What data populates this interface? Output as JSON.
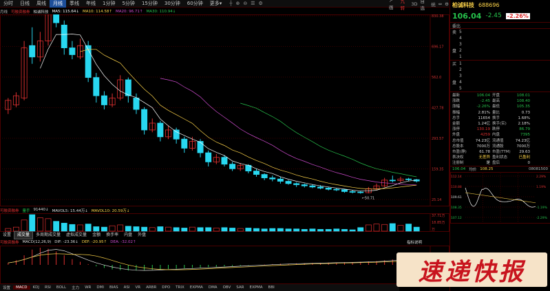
{
  "toolbar": {
    "periods": [
      {
        "label": "分时",
        "active": false
      },
      {
        "label": "日线",
        "active": false
      },
      {
        "label": "周线",
        "active": false
      },
      {
        "label": "月线",
        "active": true
      },
      {
        "label": "季线",
        "active": false
      },
      {
        "label": "年线",
        "active": false
      },
      {
        "label": "1分钟",
        "active": false
      },
      {
        "label": "5分钟",
        "active": false
      },
      {
        "label": "15分钟",
        "active": false
      },
      {
        "label": "30分钟",
        "active": false
      },
      {
        "label": "60分钟",
        "active": false
      },
      {
        "label": "更多▾",
        "active": false
      }
    ],
    "tools": [
      "┼",
      "⊕",
      "⊖",
      "☰",
      "⚙"
    ],
    "right": [
      "↗ 画",
      "九转",
      "3D",
      "自选",
      "统",
      "⇔",
      "⚙"
    ]
  },
  "main_chart": {
    "period_tag": "月线",
    "tag": "可融资融券",
    "name": "柏诚科技",
    "ma_legend": [
      {
        "label": "MA5: 115.64↓",
        "color": "#ffffff"
      },
      {
        "label": "MA10: 114.58↑",
        "color": "#ffd54a"
      },
      {
        "label": "MA20: 96.71↑",
        "color": "#d04cd0"
      },
      {
        "label": "MA30: 110.94↓",
        "color": "#27c24c"
      }
    ],
    "yticks": [
      "830.38",
      "696.17",
      "562.0",
      "427.78",
      "293.57",
      "159.35",
      "25.14"
    ],
    "high_label": "883.78",
    "low_label": "50.71"
  },
  "volume_panel": {
    "tag": "可融资融券",
    "legend": [
      {
        "label": "量手",
        "color": "#27c24c"
      },
      {
        "label": "91440↓",
        "color": "#dddddd"
      },
      {
        "label": "MAVOL5: 15.44万↓",
        "color": "#dddddd"
      },
      {
        "label": "MAVOL10: 20.59万↓",
        "color": "#ffd54a"
      }
    ],
    "yticks": [
      "37.71万",
      "18.85万",
      "万"
    ]
  },
  "sub_tabs": [
    {
      "label": "设置",
      "active": false
    },
    {
      "label": "成交量",
      "active": true
    },
    {
      "label": "多周期成交量",
      "active": false
    },
    {
      "label": "虚拟成交量",
      "active": false
    },
    {
      "label": "金额",
      "active": false
    },
    {
      "label": "换手率",
      "active": false
    },
    {
      "label": "内盘",
      "active": false
    },
    {
      "label": "外盘",
      "active": false
    }
  ],
  "macd_panel": {
    "tag": "可融资融券",
    "legend": [
      {
        "label": "MACD(12,26,9)",
        "color": "#dddddd"
      },
      {
        "label": "DIF: -23.36↓",
        "color": "#dddddd"
      },
      {
        "label": "DEF: -20.95↑",
        "color": "#ffd54a"
      },
      {
        "label": "DEA: -32.02↑",
        "color": "#d04cd0"
      }
    ],
    "hint": "指标说明"
  },
  "bottom_tabs": [
    {
      "label": "设置",
      "active": false
    },
    {
      "label": "MACD",
      "active": true
    },
    {
      "label": "KDJ",
      "active": false
    },
    {
      "label": "RSI",
      "active": false
    },
    {
      "label": "BOLL",
      "active": false
    },
    {
      "label": "主力",
      "active": false
    },
    {
      "label": "WR",
      "active": false
    },
    {
      "label": "DMI",
      "active": false
    },
    {
      "label": "BIAS",
      "active": false
    },
    {
      "label": "ASI",
      "active": false
    },
    {
      "label": "VR",
      "active": false
    },
    {
      "label": "ARBR",
      "active": false
    },
    {
      "label": "DPO",
      "active": false
    },
    {
      "label": "TRIX",
      "active": false
    },
    {
      "label": "EXPMA",
      "active": false
    },
    {
      "label": "DMA",
      "active": false
    },
    {
      "label": "OBV",
      "active": false
    },
    {
      "label": "SAR",
      "active": false
    },
    {
      "label": "EXPMA",
      "active": false
    },
    {
      "label": "BBI",
      "active": false
    }
  ],
  "quote": {
    "name": "柏诚科技",
    "code": "688696",
    "price": "106.04",
    "change": "-2.45",
    "pct": "-2.26%",
    "asks": [
      {
        "side": "卖",
        "level": "5",
        "price": "",
        "vol": ""
      },
      {
        "side": "",
        "level": "4",
        "price": "",
        "vol": ""
      },
      {
        "side": "",
        "level": "3",
        "price": "",
        "vol": ""
      },
      {
        "side": "盘",
        "level": "2",
        "price": "",
        "vol": ""
      },
      {
        "side": "",
        "level": "1",
        "price": "",
        "vol": ""
      }
    ],
    "bids": [
      {
        "side": "买",
        "level": "1",
        "price": "",
        "vol": ""
      },
      {
        "side": "",
        "level": "2",
        "price": "",
        "vol": ""
      },
      {
        "side": "",
        "level": "3",
        "price": "",
        "vol": ""
      },
      {
        "side": "盘",
        "level": "4",
        "price": "",
        "vol": ""
      },
      {
        "side": "",
        "level": "5",
        "price": "",
        "vol": ""
      }
    ],
    "ask_head": "委比",
    "fields": [
      [
        "最新",
        "106.04",
        "开盘",
        "108.01"
      ],
      [
        "涨跌",
        "-2.45",
        "最高",
        "108.40"
      ],
      [
        "涨幅",
        "-2.26%",
        "最低",
        "105.35"
      ],
      [
        "振幅",
        "2.81%",
        "量比",
        "0.73"
      ],
      [
        "总手",
        "11654",
        "换手",
        "1.68%"
      ],
      [
        "金额",
        "1.24亿",
        "换手(实)",
        "2.18%"
      ],
      [
        "涨停",
        "130.19",
        "跌停",
        "86.79"
      ],
      [
        "外盘",
        "4259",
        "内盘",
        "7395"
      ],
      [
        "总市值",
        "74.23亿",
        "流通值",
        "74.23亿"
      ],
      [
        "总股本",
        "7000万",
        "流通股",
        "7000万"
      ],
      [
        "市盈(静)",
        "61.78",
        "市盈(TTM)",
        "29.63"
      ],
      [
        "表决权",
        "无差异",
        "盈利状态",
        "已盈利"
      ],
      [
        "注册制",
        "是",
        "盘后",
        "0"
      ]
    ],
    "field_colors": [
      [
        "green",
        "green"
      ],
      [
        "green",
        "green"
      ],
      [
        "green",
        "green"
      ],
      [
        "white",
        "white"
      ],
      [
        "white",
        "white"
      ],
      [
        "white",
        "white"
      ],
      [
        "red",
        "green"
      ],
      [
        "red",
        "green"
      ],
      [
        "white",
        "white"
      ],
      [
        "white",
        "white"
      ],
      [
        "white",
        "white"
      ],
      [
        "yellow",
        "yellow"
      ],
      [
        "white",
        "white"
      ]
    ],
    "mini": {
      "label_price": "106.04",
      "label_avg": "均价",
      "label_avg_val": "108.25",
      "label_time": "08081500",
      "left_ticks": [
        "112.14",
        "110.88",
        "109.61",
        "108.35",
        "107.12"
      ],
      "right_ticks": [
        "2.29%",
        "1.19%",
        "",
        "-1.19%",
        "-2.29%"
      ]
    }
  },
  "watermark": "速递快报",
  "chart_data": {
    "type": "candlestick",
    "series": [
      {
        "name": "MA5",
        "color": "#ffffff"
      },
      {
        "name": "MA10",
        "color": "#ffd54a"
      },
      {
        "name": "MA20",
        "color": "#d04cd0"
      },
      {
        "name": "MA30",
        "color": "#27c24c"
      }
    ],
    "high": 883.78,
    "low": 50.71,
    "ylim": [
      25.14,
      830.38
    ],
    "candles": [
      [
        420,
        460,
        470,
        400
      ],
      [
        440,
        480,
        495,
        430
      ],
      [
        470,
        690,
        720,
        460
      ],
      [
        700,
        650,
        780,
        620
      ],
      [
        650,
        720,
        760,
        630
      ],
      [
        720,
        883,
        883.78,
        700
      ],
      [
        860,
        800,
        880,
        780
      ],
      [
        790,
        690,
        810,
        660
      ],
      [
        690,
        660,
        720,
        640
      ],
      [
        650,
        700,
        730,
        640
      ],
      [
        700,
        560,
        720,
        540
      ],
      [
        560,
        480,
        580,
        450
      ],
      [
        480,
        440,
        500,
        420
      ],
      [
        440,
        470,
        490,
        430
      ],
      [
        470,
        550,
        570,
        460
      ],
      [
        550,
        480,
        560,
        450
      ],
      [
        470,
        420,
        490,
        400
      ],
      [
        420,
        330,
        430,
        310
      ],
      [
        330,
        360,
        380,
        320
      ],
      [
        360,
        300,
        370,
        280
      ],
      [
        300,
        330,
        350,
        290
      ],
      [
        330,
        290,
        340,
        270
      ],
      [
        290,
        250,
        300,
        230
      ],
      [
        250,
        280,
        300,
        240
      ],
      [
        280,
        230,
        290,
        210
      ],
      [
        230,
        190,
        240,
        170
      ],
      [
        190,
        210,
        225,
        180
      ],
      [
        210,
        180,
        220,
        170
      ],
      [
        180,
        160,
        190,
        150
      ],
      [
        160,
        175,
        185,
        150
      ],
      [
        175,
        150,
        180,
        140
      ],
      [
        150,
        135,
        160,
        125
      ],
      [
        135,
        120,
        140,
        110
      ],
      [
        120,
        115,
        130,
        105
      ],
      [
        115,
        105,
        125,
        95
      ],
      [
        105,
        95,
        110,
        90
      ],
      [
        95,
        90,
        100,
        80
      ],
      [
        90,
        85,
        95,
        78
      ],
      [
        85,
        80,
        92,
        75
      ],
      [
        80,
        75,
        88,
        70
      ],
      [
        75,
        70,
        80,
        65
      ],
      [
        70,
        68,
        76,
        62
      ],
      [
        68,
        60,
        72,
        55
      ],
      [
        60,
        58,
        66,
        52
      ],
      [
        58,
        55,
        62,
        50.71
      ],
      [
        55,
        72,
        80,
        52
      ],
      [
        72,
        85,
        95,
        68
      ],
      [
        85,
        110,
        120,
        80
      ],
      [
        110,
        108,
        130,
        100
      ],
      [
        108,
        115,
        125,
        100
      ],
      [
        115,
        112,
        120,
        105
      ],
      [
        112,
        106,
        115,
        100
      ]
    ],
    "volume": [
      6,
      9,
      25,
      37,
      30,
      28,
      22,
      18,
      15,
      14,
      16,
      10,
      9,
      12,
      14,
      11,
      10,
      9,
      8,
      10,
      9,
      8,
      7,
      9,
      8,
      8,
      7,
      8,
      7,
      6,
      7,
      6,
      5,
      6,
      6,
      5,
      5,
      4,
      5,
      4,
      4,
      5,
      4,
      3,
      8,
      14,
      16,
      15,
      17,
      13,
      16,
      9
    ],
    "macd": [
      5,
      12,
      25,
      40,
      45,
      42,
      35,
      25,
      15,
      8,
      2,
      -4,
      -8,
      -12,
      -14,
      -15,
      -15,
      -14,
      -13,
      -12,
      -11,
      -10,
      -9,
      -8,
      -7,
      -6,
      -5,
      -4,
      -3,
      -2,
      -1,
      0,
      1,
      2,
      3,
      3,
      4,
      4,
      5,
      5,
      6,
      6,
      7,
      7,
      8,
      9,
      10,
      12,
      14,
      12,
      10,
      8
    ]
  }
}
